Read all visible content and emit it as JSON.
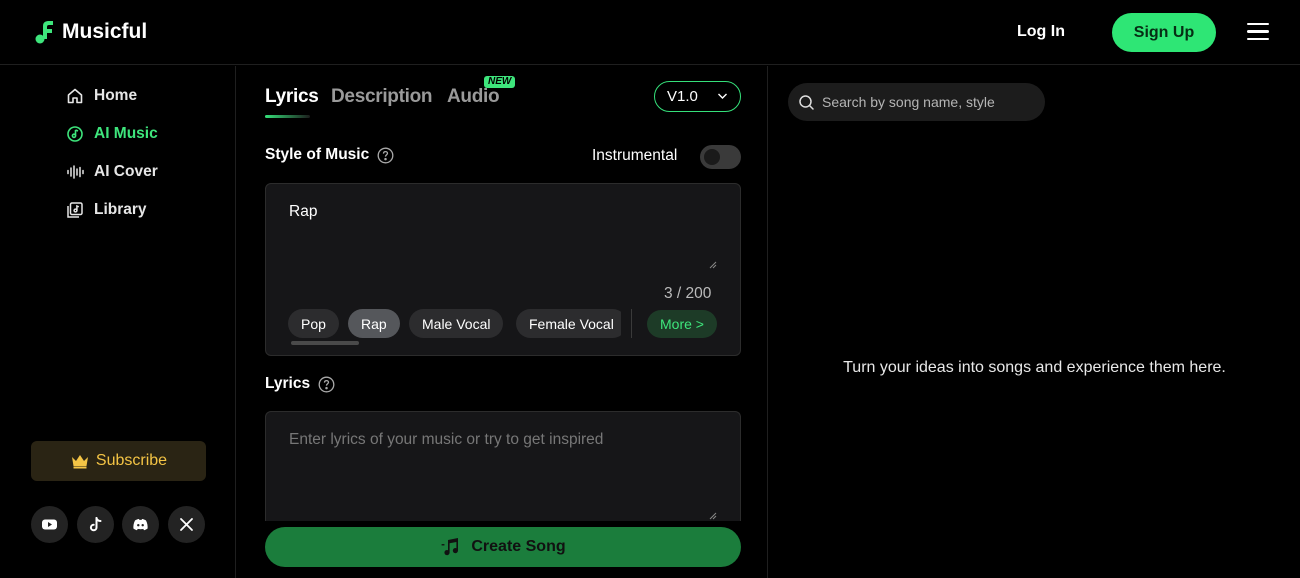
{
  "header": {
    "brand": "Musicful",
    "login_label": "Log In",
    "signup_label": "Sign Up",
    "accent_color": "#2ee675"
  },
  "sidebar": {
    "items": [
      {
        "label": "Home",
        "icon": "home-icon",
        "active": false
      },
      {
        "label": "AI Music",
        "icon": "music-disc-icon",
        "active": true
      },
      {
        "label": "AI Cover",
        "icon": "waveform-icon",
        "active": false
      },
      {
        "label": "Library",
        "icon": "library-icon",
        "active": false
      }
    ],
    "subscribe_label": "Subscribe",
    "socials": [
      "youtube-icon",
      "tiktok-icon",
      "discord-icon",
      "x-icon"
    ]
  },
  "composer": {
    "tabs": [
      {
        "label": "Lyrics",
        "active": true
      },
      {
        "label": "Description",
        "active": false
      },
      {
        "label": "Audio",
        "active": false,
        "badge": "NEW"
      }
    ],
    "version": "V1.0",
    "style_label": "Style of Music",
    "instrumental_label": "Instrumental",
    "instrumental_on": false,
    "style_value": "Rap",
    "style_counter": "3 / 200",
    "chips": [
      {
        "label": "Pop",
        "selected": false
      },
      {
        "label": "Rap",
        "selected": true
      },
      {
        "label": "Male Vocal",
        "selected": false
      },
      {
        "label": "Female Vocal",
        "selected": false
      }
    ],
    "more_label": "More >",
    "lyrics_label": "Lyrics",
    "lyrics_placeholder": "Enter lyrics of your music or try to get inspired",
    "create_label": "Create Song"
  },
  "results": {
    "search_placeholder": "Search by song name, style",
    "empty_message": "Turn your ideas into songs and experience them here."
  }
}
